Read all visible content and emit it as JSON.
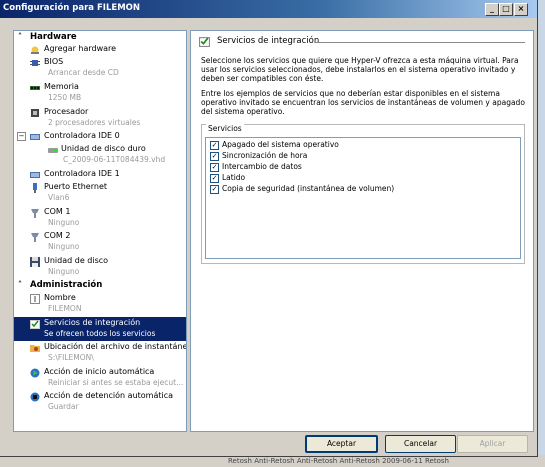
{
  "window": {
    "title": "Configuración para FILEMON"
  },
  "sections": {
    "hardware": "Hardware",
    "administracion": "Administración"
  },
  "hardware_items": [
    {
      "name": "Agregar hardware",
      "sub": ""
    },
    {
      "name": "BIOS",
      "sub": "Arrancar desde CD"
    },
    {
      "name": "Memoria",
      "sub": "1250 MB"
    },
    {
      "name": "Procesador",
      "sub": "2 procesadores virtuales"
    },
    {
      "name": "Controladora IDE 0",
      "sub": ""
    },
    {
      "name": "Unidad de disco duro",
      "sub": "C_2009-06-11T084439.vhd"
    },
    {
      "name": "Controladora IDE 1",
      "sub": ""
    },
    {
      "name": "Puerto Ethernet",
      "sub": "Vlan6"
    },
    {
      "name": "COM 1",
      "sub": "Ninguno"
    },
    {
      "name": "COM 2",
      "sub": "Ninguno"
    },
    {
      "name": "Unidad de disco",
      "sub": "Ninguno"
    }
  ],
  "admin_items": [
    {
      "name": "Nombre",
      "sub": "FILEMON"
    },
    {
      "name": "Servicios de integración",
      "sub": "Se ofrecen todos los servicios"
    },
    {
      "name": "Ubicación del archivo de instantánea",
      "sub": "S:\\FILEMON\\"
    },
    {
      "name": "Acción de inicio automática",
      "sub": "Reiniciar si antes se estaba ejecut..."
    },
    {
      "name": "Acción de detención automática",
      "sub": "Guardar"
    }
  ],
  "panel": {
    "header": "Servicios de integración",
    "para1": "Seleccione los servicios que quiere que Hyper-V ofrezca a esta máquina virtual. Para usar los servicios seleccionados, debe instalarlos en el sistema operativo invitado y deben ser compatibles con éste.",
    "para2": "Entre los ejemplos de servicios que no deberían estar disponibles en el sistema operativo invitado se encuentran los servicios de instantáneas de volumen y apagado del sistema operativo.",
    "group_label": "Servicios",
    "services": [
      {
        "label": "Apagado del sistema operativo",
        "checked": true
      },
      {
        "label": "Sincronización de hora",
        "checked": true
      },
      {
        "label": "Intercambio de datos",
        "checked": true
      },
      {
        "label": "Latido",
        "checked": true
      },
      {
        "label": "Copia de seguridad (instantánea de volumen)",
        "checked": true
      }
    ]
  },
  "buttons": {
    "accept": "Aceptar",
    "cancel": "Cancelar",
    "apply": "Aplicar"
  },
  "background": {
    "text": "Retosh    Anti-Retosh    Anti-Retosh    Anti-Retosh    2009-06-11 Retosh"
  }
}
